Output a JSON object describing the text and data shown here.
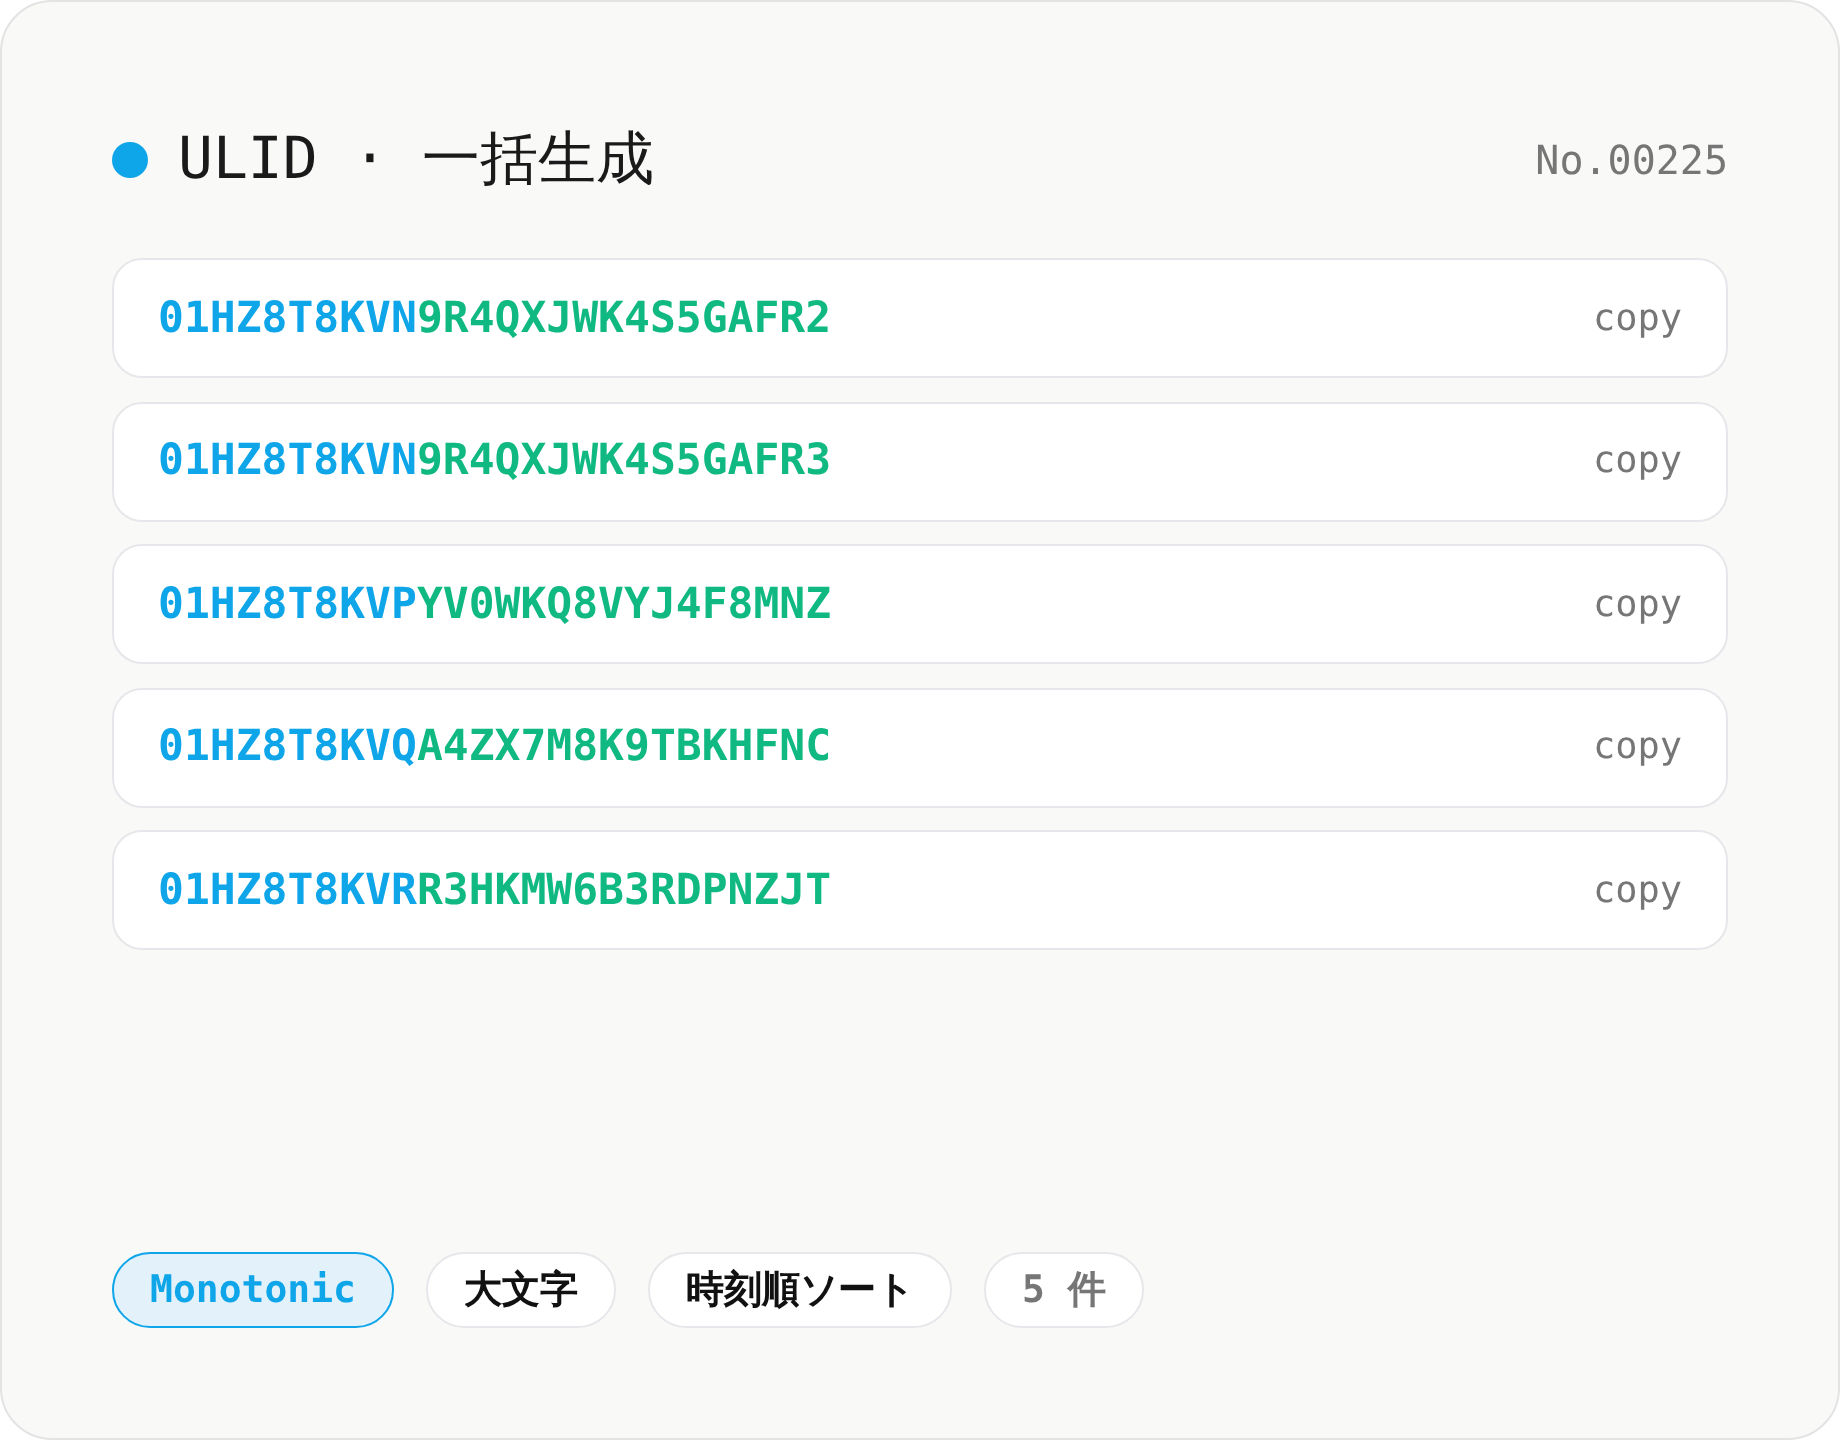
{
  "header": {
    "title": "ULID · 一括生成",
    "serial": "No.00225"
  },
  "ulids": [
    {
      "timestamp": "01HZ8T8KVN",
      "randomness": "9R4QXJWK4S5GAFR2",
      "action": "copy"
    },
    {
      "timestamp": "01HZ8T8KVN",
      "randomness": "9R4QXJWK4S5GAFR3",
      "action": "copy"
    },
    {
      "timestamp": "01HZ8T8KVP",
      "randomness": "YV0WKQ8VYJ4F8MNZ",
      "action": "copy"
    },
    {
      "timestamp": "01HZ8T8KVQ",
      "randomness": "A4ZX7M8K9TBKHFNC",
      "action": "copy"
    },
    {
      "timestamp": "01HZ8T8KVR",
      "randomness": "R3HKMW6B3RDPNZJT",
      "action": "copy"
    }
  ],
  "footer": {
    "options": [
      {
        "label": "Monotonic",
        "selected": true
      },
      {
        "label": "大文字",
        "selected": false
      },
      {
        "label": "時刻順ソート",
        "selected": false
      }
    ],
    "count": "5 件"
  }
}
